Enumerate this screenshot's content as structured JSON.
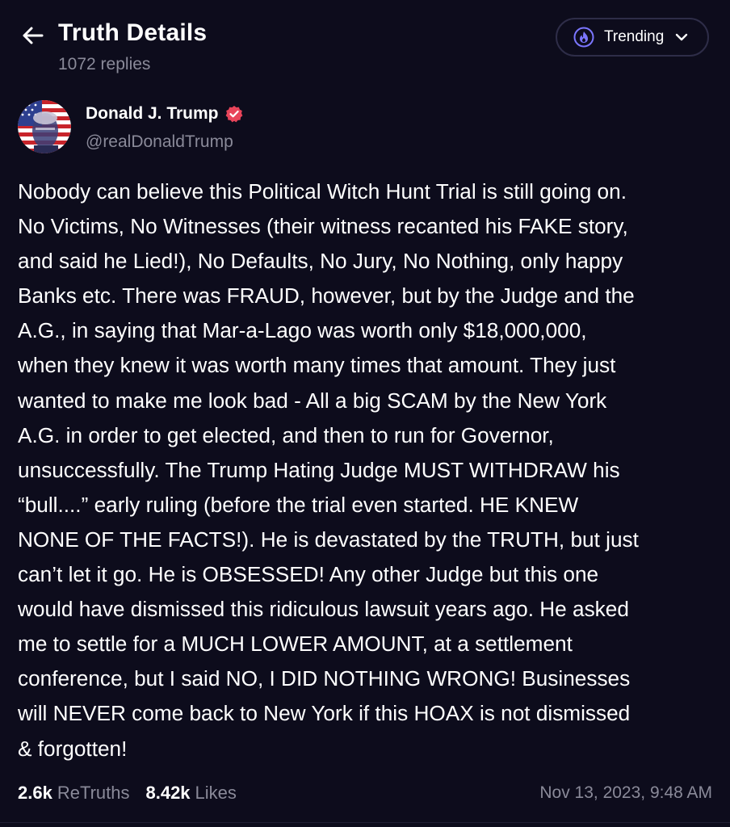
{
  "header": {
    "title": "Truth Details",
    "reply_count": "1072 replies",
    "back_icon": "arrow-left-icon",
    "feed_selector": {
      "label": "Trending",
      "icon": "flame-icon",
      "dropdown_icon": "chevron-down-icon"
    }
  },
  "post": {
    "author": {
      "name": "Donald J. Trump",
      "handle": "@realDonaldTrump",
      "verified": true,
      "verified_color": "#e8445a"
    },
    "body": "Nobody can believe this Political Witch Hunt Trial is still going on.\nNo Victims, No Witnesses (their witness recanted his FAKE story,\nand said he Lied!), No Defaults, No Jury, No Nothing, only happy\nBanks etc. There was FRAUD, however, but by the Judge and the\nA.G., in saying that Mar-a-Lago was worth only $18,000,000,\nwhen they knew it was worth many times that amount. They just\nwanted to make me look bad - All a big SCAM by the New York\nA.G. in order to get elected, and then to run for Governor,\nunsuccessfully. The Trump Hating Judge MUST WITHDRAW his\n“bull....” early ruling (before the trial even started. HE KNEW\nNONE OF THE FACTS!). He is devastated by the TRUTH, but just\ncan’t let it go. He is OBSESSED! Any other Judge but this one\nwould have dismissed this ridiculous lawsuit years ago. He asked\nme to settle for a MUCH LOWER AMOUNT, at a settlement\nconference, but I said NO, I DID NOTHING WRONG! Businesses\nwill NEVER come back to New York if this HOAX is not dismissed\n& forgotten!",
    "stats": {
      "retruths_count": "2.6k",
      "retruths_label": "ReTruths",
      "likes_count": "8.42k",
      "likes_label": "Likes"
    },
    "timestamp": "Nov 13, 2023, 9:48 AM"
  },
  "colors": {
    "background": "#0d0c1c",
    "text_primary": "#ffffff",
    "text_secondary": "#8a8a99",
    "accent": "#5448ee",
    "border": "#2e2d48"
  }
}
